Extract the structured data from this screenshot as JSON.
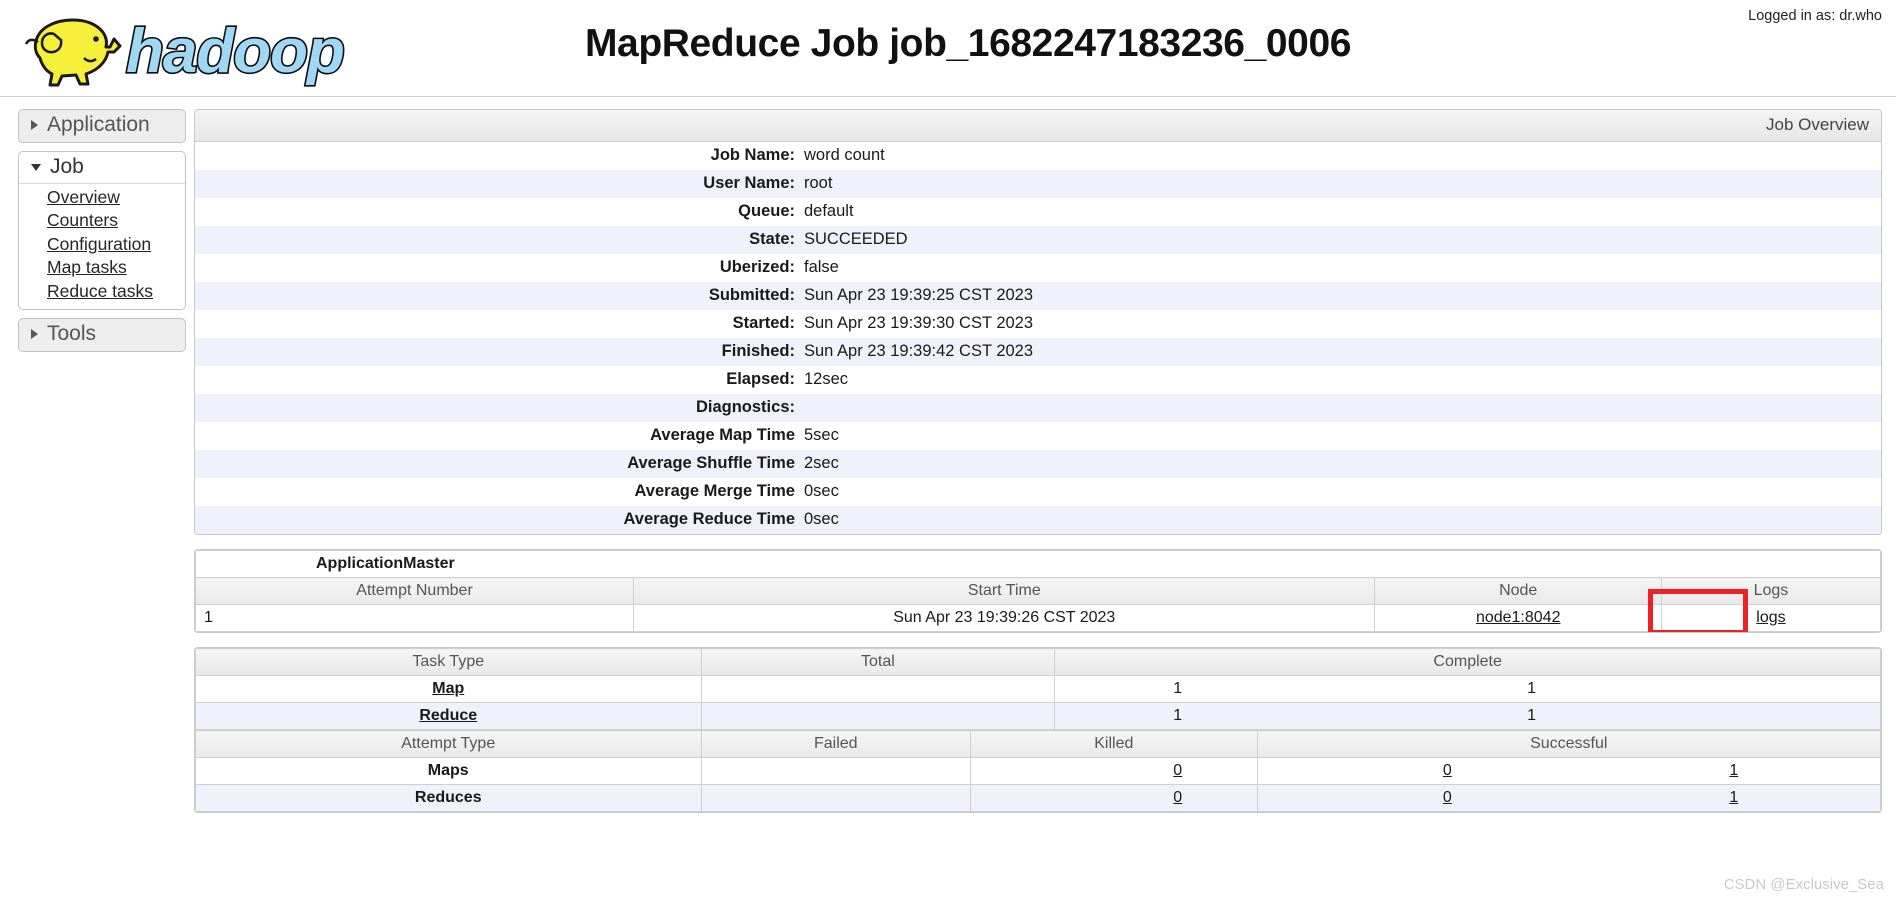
{
  "header": {
    "logo_alt": "hadoop-logo",
    "logo_text": "hadoop",
    "title": "MapReduce Job job_1682247183236_0006",
    "login": "Logged in as: dr.who"
  },
  "nav": {
    "sections": [
      {
        "label": "Application",
        "state": "collapsed",
        "links": []
      },
      {
        "label": "Job",
        "state": "open",
        "links": [
          "Overview",
          "Counters",
          "Configuration",
          "Map tasks",
          "Reduce tasks"
        ]
      },
      {
        "label": "Tools",
        "state": "collapsed",
        "links": []
      }
    ]
  },
  "job_overview": {
    "banner": "Job Overview",
    "rows": [
      {
        "key": "Job Name:",
        "value": "word count"
      },
      {
        "key": "User Name:",
        "value": "root"
      },
      {
        "key": "Queue:",
        "value": "default"
      },
      {
        "key": "State:",
        "value": "SUCCEEDED"
      },
      {
        "key": "Uberized:",
        "value": "false"
      },
      {
        "key": "Submitted:",
        "value": "Sun Apr 23 19:39:25 CST 2023"
      },
      {
        "key": "Started:",
        "value": "Sun Apr 23 19:39:30 CST 2023"
      },
      {
        "key": "Finished:",
        "value": "Sun Apr 23 19:39:42 CST 2023"
      },
      {
        "key": "Elapsed:",
        "value": "12sec"
      },
      {
        "key": "Diagnostics:",
        "value": ""
      },
      {
        "key": "Average Map Time",
        "value": "5sec"
      },
      {
        "key": "Average Shuffle Time",
        "value": "2sec"
      },
      {
        "key": "Average Merge Time",
        "value": "0sec"
      },
      {
        "key": "Average Reduce Time",
        "value": "0sec"
      }
    ]
  },
  "app_master": {
    "title": "ApplicationMaster",
    "columns": [
      "Attempt Number",
      "Start Time",
      "Node",
      "Logs"
    ],
    "row": {
      "attempt_number": "1",
      "start_time": "Sun Apr 23 19:39:26 CST 2023",
      "node": "node1:8042",
      "logs": "logs"
    },
    "highlight_color": "#ee2222"
  },
  "task_table": {
    "columns": [
      "Task Type",
      "Total",
      "Complete"
    ],
    "rows": [
      {
        "type": "Map",
        "total": "1",
        "complete": "1"
      },
      {
        "type": "Reduce",
        "total": "1",
        "complete": "1"
      }
    ],
    "attempt_columns": [
      "Attempt Type",
      "Failed",
      "Killed",
      "Successful"
    ],
    "attempt_rows": [
      {
        "type": "Maps",
        "failed": "0",
        "killed": "0",
        "successful": "1"
      },
      {
        "type": "Reduces",
        "failed": "0",
        "killed": "0",
        "successful": "1"
      }
    ]
  },
  "watermark": "CSDN @Exclusive_Sea"
}
